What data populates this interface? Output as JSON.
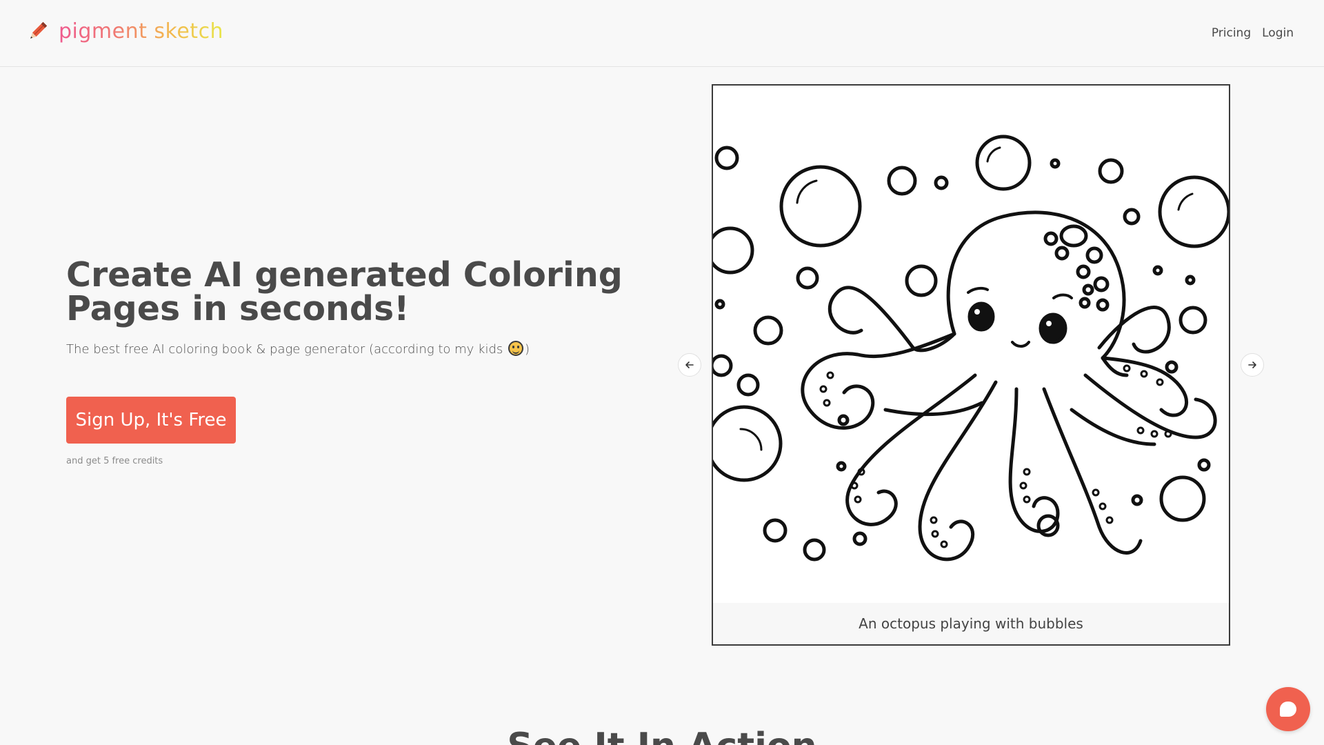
{
  "header": {
    "logo_text": "pigment sketch",
    "logo_icon": "pencil-icon",
    "nav": {
      "pricing": "Pricing",
      "login": "Login"
    }
  },
  "hero": {
    "title": "Create AI generated Coloring Pages in seconds!",
    "subtitle_before": "The best free AI coloring book & page generator (according to my kids ",
    "subtitle_after": ")",
    "emoji": "smiling-face-icon",
    "cta_label": "Sign Up, It's Free",
    "cta_note": "and get 5 free credits"
  },
  "carousel": {
    "caption": "An octopus playing with bubbles",
    "prev_icon": "arrow-left-icon",
    "next_icon": "arrow-right-icon"
  },
  "section": {
    "title": "See It In Action"
  },
  "chat": {
    "icon": "chat-bubble-icon"
  },
  "colors": {
    "accent": "#f0614f",
    "text": "#4a4a4a",
    "background": "#f8f8f8"
  }
}
